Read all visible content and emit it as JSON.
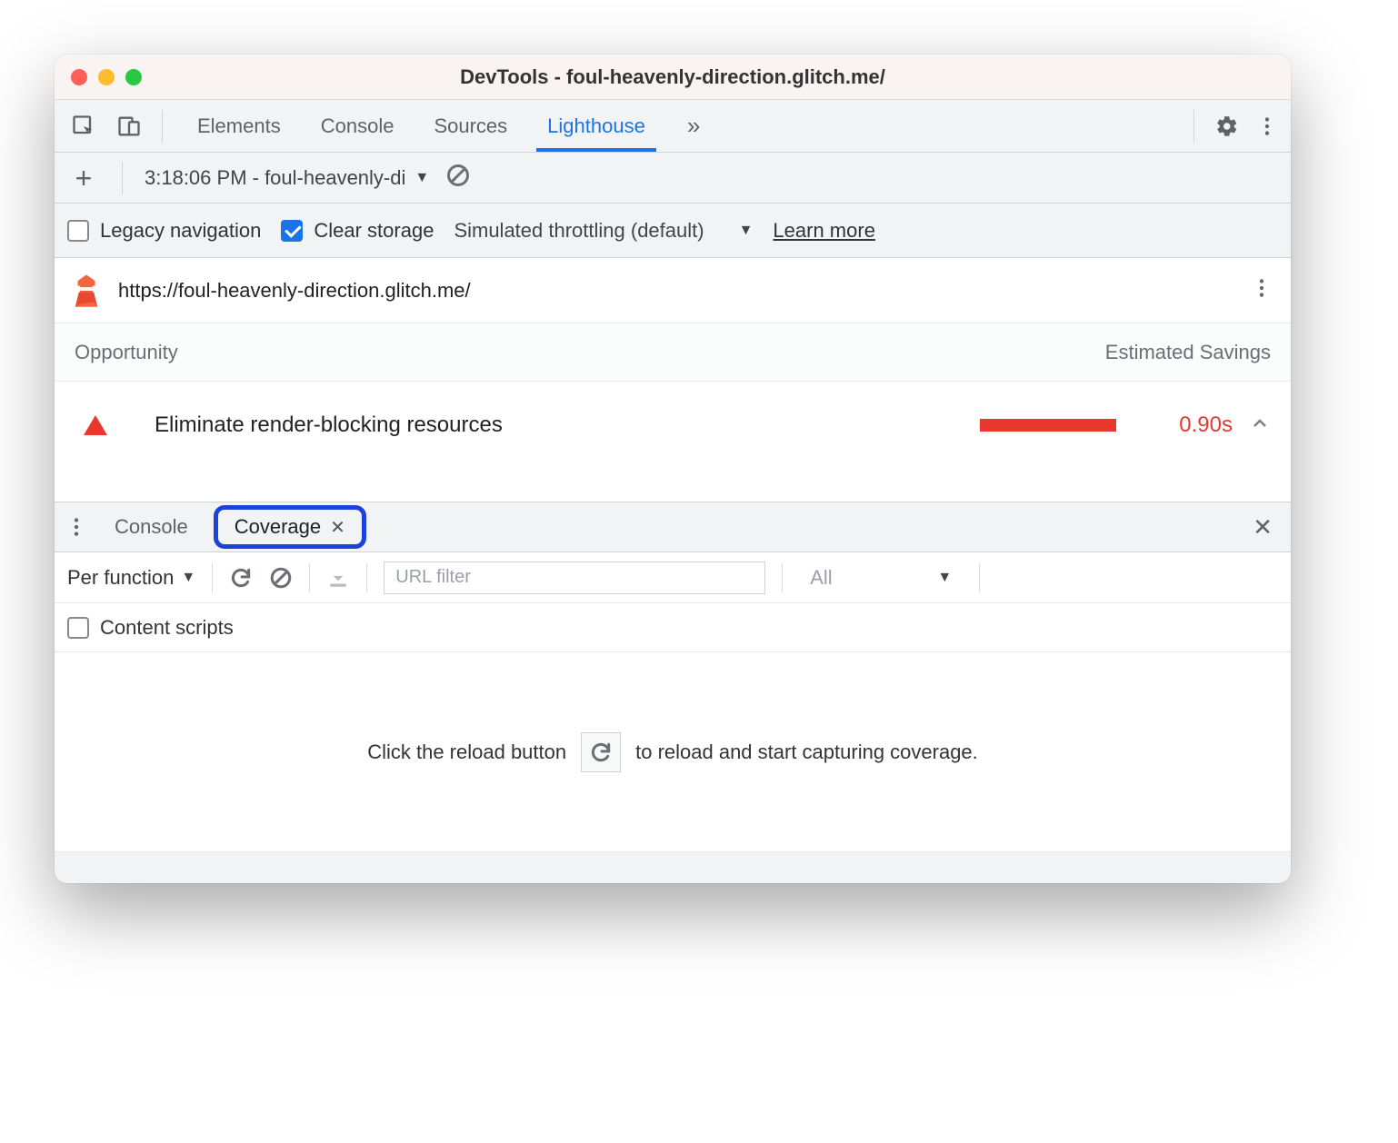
{
  "window": {
    "title": "DevTools - foul-heavenly-direction.glitch.me/"
  },
  "maintabs": {
    "elements": "Elements",
    "console": "Console",
    "sources": "Sources",
    "lighthouse": "Lighthouse"
  },
  "subbar": {
    "report_select": "3:18:06 PM - foul-heavenly-di"
  },
  "options": {
    "legacy_nav": "Legacy navigation",
    "clear_storage": "Clear storage",
    "throttling": "Simulated throttling (default)",
    "learn_more": "Learn more"
  },
  "report": {
    "url": "https://foul-heavenly-direction.glitch.me/"
  },
  "opp": {
    "head_left": "Opportunity",
    "head_right": "Estimated Savings",
    "row_title": "Eliminate render-blocking resources",
    "row_value": "0.90s"
  },
  "drawer": {
    "console": "Console",
    "coverage": "Coverage"
  },
  "coverage": {
    "granularity": "Per function",
    "url_filter_placeholder": "URL filter",
    "type_filter": "All",
    "content_scripts": "Content scripts",
    "hint_left": "Click the reload button",
    "hint_right": "to reload and start capturing coverage."
  }
}
